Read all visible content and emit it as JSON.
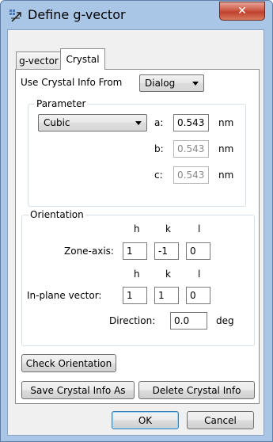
{
  "window": {
    "title": "Define g-vector",
    "close_glyph": "✕"
  },
  "tabs": [
    {
      "label": "g-vector",
      "active": false
    },
    {
      "label": "Crystal",
      "active": true
    }
  ],
  "crystal": {
    "source_label": "Use Crystal Info From",
    "source_value": "Dialog",
    "parameter": {
      "title": "Parameter",
      "lattice": "Cubic",
      "a_label": "a:",
      "a_value": "0.543",
      "b_label": "b:",
      "b_value": "0.543",
      "c_label": "c:",
      "c_value": "0.543",
      "unit": "nm"
    },
    "orientation": {
      "title": "Orientation",
      "h_label": "h",
      "k_label": "k",
      "l_label": "l",
      "zone_axis_label": "Zone-axis:",
      "zone_axis": [
        "1",
        "-1",
        "0"
      ],
      "inplane_label": "In-plane vector:",
      "inplane": [
        "1",
        "1",
        "0"
      ],
      "direction_label": "Direction:",
      "direction_value": "0.0",
      "direction_unit": "deg"
    },
    "check_orientation_label": "Check Orientation",
    "save_label": "Save Crystal Info As",
    "delete_label": "Delete Crystal Info"
  },
  "footer": {
    "ok_label": "OK",
    "cancel_label": "Cancel"
  }
}
